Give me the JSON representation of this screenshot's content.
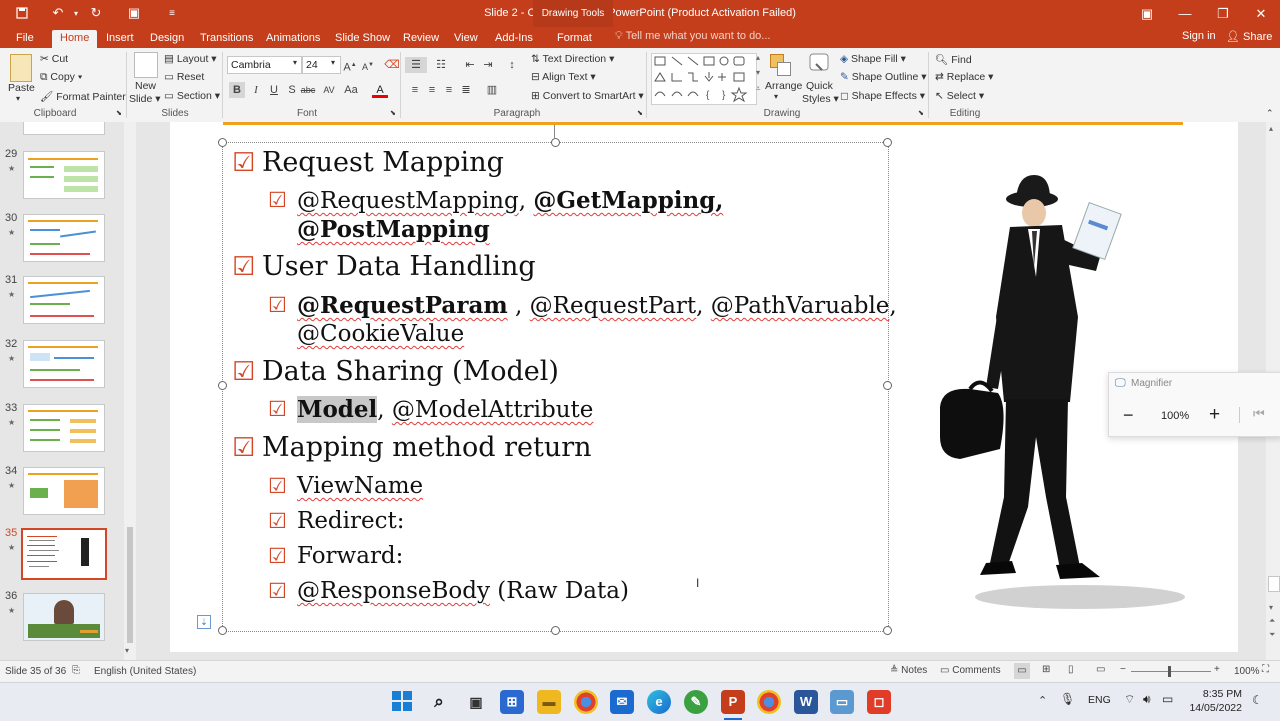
{
  "app": {
    "title": "Slide 2 - Controller.pptx - PowerPoint (Product Activation Failed)",
    "drawing_tools": "Drawing Tools",
    "sign_in": "Sign in",
    "share": "Share",
    "colors": {
      "accent": "#c43e1c",
      "check": "#d24726",
      "orange_bar": "#f0a020"
    }
  },
  "tabs": [
    "File",
    "Home",
    "Insert",
    "Design",
    "Transitions",
    "Animations",
    "Slide Show",
    "Review",
    "View",
    "Add-Ins",
    "Format"
  ],
  "active_tab": "Home",
  "tell_me": "Tell me what you want to do...",
  "ribbon": {
    "clipboard": {
      "paste": "Paste",
      "cut": "Cut",
      "copy": "Copy",
      "format_painter": "Format Painter",
      "label": "Clipboard"
    },
    "slides": {
      "new_slide_1": "New",
      "new_slide_2": "Slide",
      "layout": "Layout",
      "reset": "Reset",
      "section": "Section",
      "label": "Slides"
    },
    "font": {
      "family": "Cambria",
      "size": "24",
      "label": "Font"
    },
    "paragraph": {
      "text_direction": "Text Direction",
      "align_text": "Align Text",
      "convert_smartart": "Convert to SmartArt",
      "label": "Paragraph"
    },
    "drawing": {
      "arrange": "Arrange",
      "quick_styles_1": "Quick",
      "quick_styles_2": "Styles",
      "shape_fill": "Shape Fill",
      "shape_outline": "Shape Outline",
      "shape_effects": "Shape Effects",
      "label": "Drawing"
    },
    "editing": {
      "find": "Find",
      "replace": "Replace",
      "select": "Select",
      "label": "Editing"
    }
  },
  "thumbnails": [
    {
      "num": "29",
      "star": "★"
    },
    {
      "num": "30",
      "star": "★"
    },
    {
      "num": "31",
      "star": "★"
    },
    {
      "num": "32",
      "star": "★"
    },
    {
      "num": "33",
      "star": "★"
    },
    {
      "num": "34",
      "star": "★"
    },
    {
      "num": "35",
      "star": "★"
    },
    {
      "num": "36",
      "star": "★"
    }
  ],
  "selected_slide": "35",
  "slide": {
    "b1": "Request Mapping",
    "b1a": "@RequestMapping",
    "b1b": ", ",
    "b1c": "@GetMapping,",
    "b1d": "@PostMapping",
    "b2": "User Data Handling",
    "b2a": "@RequestParam",
    "b2b": " , ",
    "b2c": "@RequestPart",
    "b2d": ", ",
    "b2e": "@PathVaruable",
    "b2f": ",",
    "b2g": "@CookieValue",
    "b3": "Data Sharing (Model)",
    "b3a": "Model",
    "b3b": ", ",
    "b3c": "@ModelAttribute",
    "b4": "Mapping method return",
    "b4a": "ViewName",
    "b4b": "Redirect:",
    "b4c": "Forward:",
    "b4d": "@ResponseBody",
    "b4e": " (Raw Data)",
    "check": "☑"
  },
  "magnifier": {
    "title": "Magnifier",
    "zoom": "100%"
  },
  "status": {
    "slide_info": "Slide 35 of 36",
    "language": "English (United States)",
    "notes": "Notes",
    "comments": "Comments",
    "zoom": "100%"
  },
  "taskbar": {
    "lang": "ENG",
    "time": "8:35 PM",
    "date": "14/05/2022"
  }
}
